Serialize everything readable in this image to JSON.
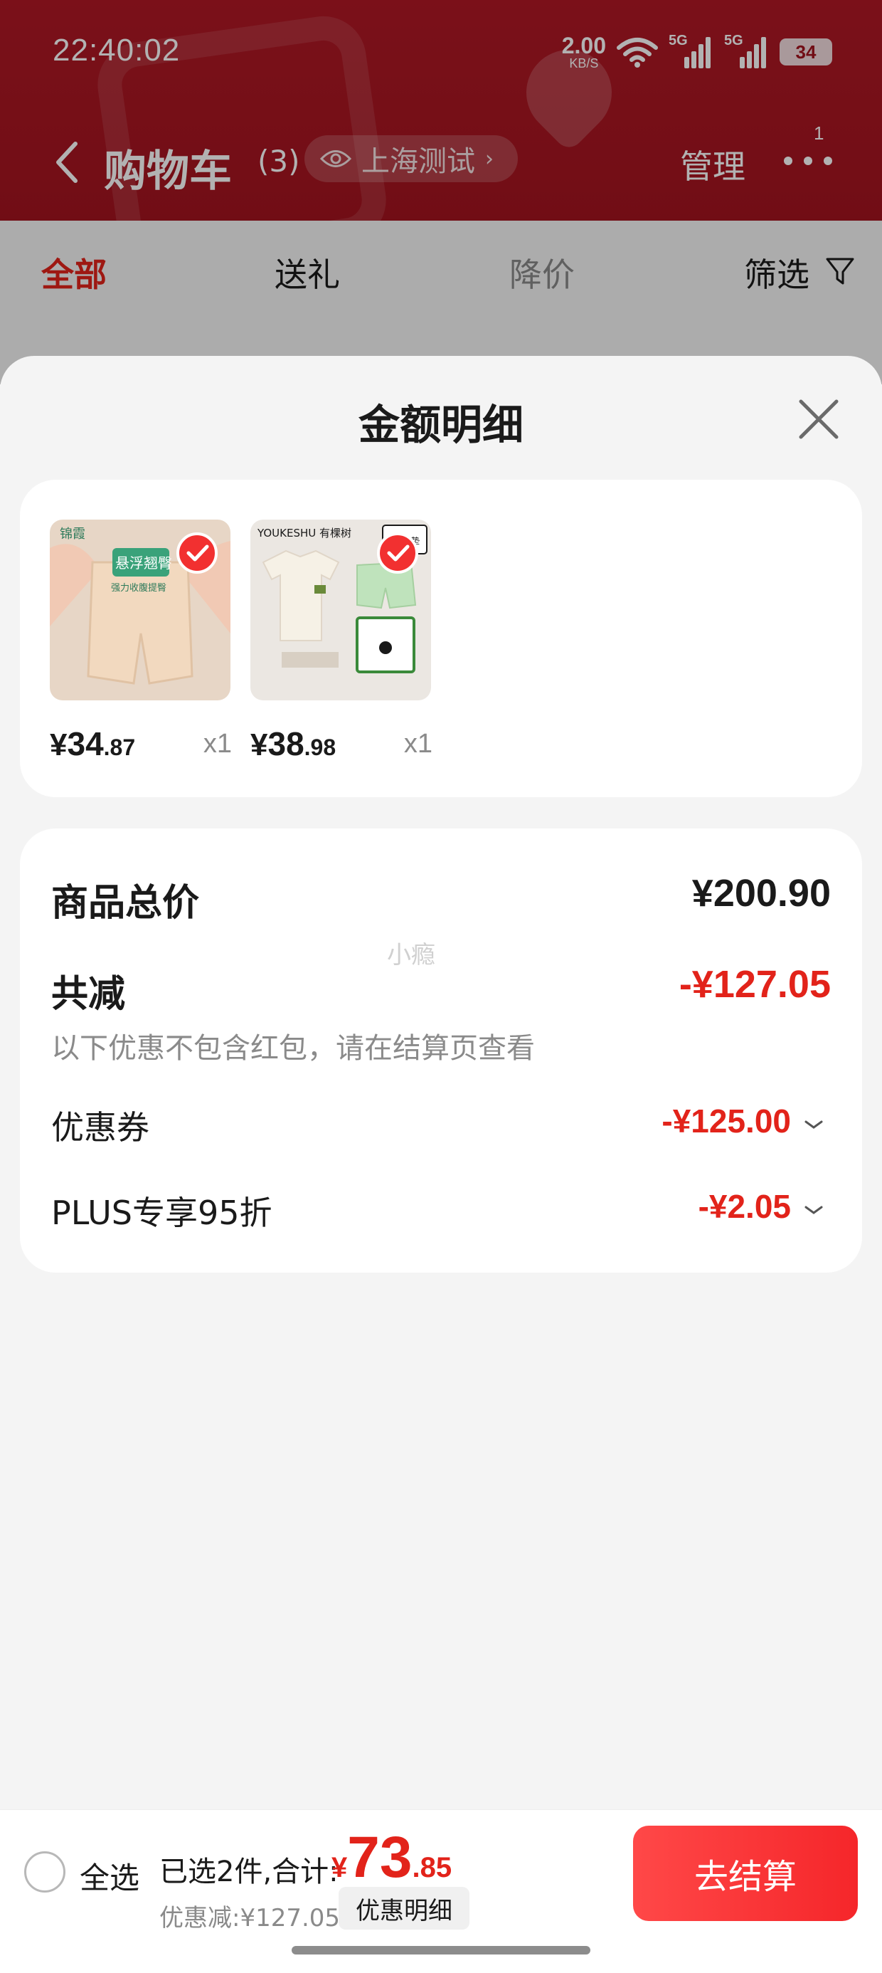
{
  "status_bar": {
    "time": "22:40:02",
    "net_speed_value": "2.00",
    "net_speed_unit": "KB/S",
    "sim1_label": "5G",
    "sim2_label": "5G",
    "battery": "34"
  },
  "header": {
    "title": "购物车",
    "count": "(3)",
    "location": "上海测试",
    "manage_label": "管理",
    "more_badge": "1",
    "brand_color": "#a3141f"
  },
  "tabs": [
    "全部",
    "送礼",
    "降价",
    "筛选"
  ],
  "sheet": {
    "title": "金额明细",
    "products": [
      {
        "price_symbol": "¥",
        "price_int": "34",
        "price_dec": ".87",
        "qty": "x1",
        "thumb_brand": "锦霞",
        "thumb_caption": "悬浮翘臀",
        "thumb_sub": "强力收腹提臀",
        "thumb_name": "beige-shapewear-shorts"
      },
      {
        "price_symbol": "¥",
        "price_int": "38",
        "price_dec": ".98",
        "qty": "x1",
        "thumb_brand": "YOUKESHU 有棵树",
        "thumb_caption": "自带杯垫",
        "thumb_name": "tshirt-shorts-set"
      }
    ],
    "summary": {
      "total_label": "商品总价",
      "total_value": "¥200.90",
      "reduction_label": "共减",
      "reduction_value": "-¥127.05",
      "note": "以下优惠不包含红包，请在结算页查看",
      "coupon_label": "优惠券",
      "coupon_value": "-¥125.00",
      "plus_label": "PLUS专享95折",
      "plus_value": "-¥2.05",
      "watermark": "小瘾"
    }
  },
  "bottom_bar": {
    "select_all_label": "全选",
    "selected_text": "已选2件,合计:",
    "total_symbol": "¥",
    "total_int": "73",
    "total_dec": ".85",
    "discount_text": "优惠减:¥127.05",
    "detail_chip": "优惠明细",
    "checkout_label": "去结算",
    "accent": "#e2231a"
  }
}
